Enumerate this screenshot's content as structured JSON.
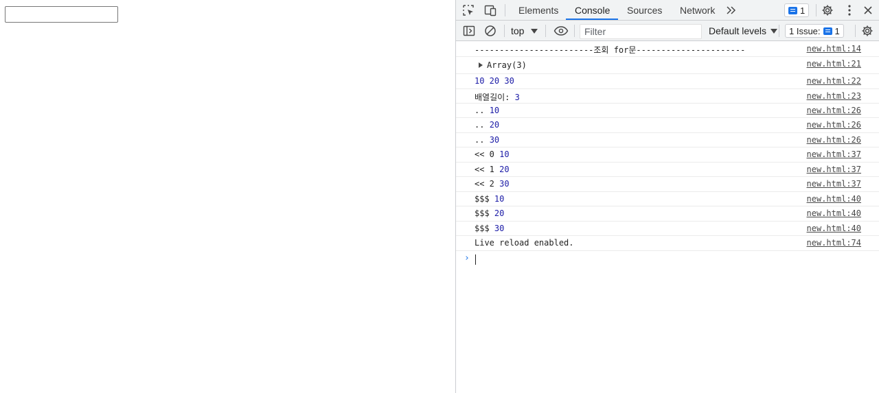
{
  "devtools": {
    "tabs": [
      "Elements",
      "Console",
      "Sources",
      "Network"
    ],
    "active_tab": "Console",
    "message_count": "1",
    "context": "top",
    "filter_placeholder": "Filter",
    "levels": "Default levels",
    "issues_label": "1 Issue:",
    "issues_count": "1",
    "accent_color": "#1a73e8"
  },
  "console": {
    "rows": [
      {
        "text": "------------------------조회 for문----------------------",
        "value": "",
        "source": "new.html:14"
      },
      {
        "text": "Array(3)",
        "value": "",
        "source": "new.html:21"
      },
      {
        "text": "",
        "value": "10 20 30",
        "source": "new.html:22"
      },
      {
        "text": "배열길이: ",
        "value": "3",
        "source": "new.html:23"
      },
      {
        "text": ".. ",
        "value": "10",
        "source": "new.html:26"
      },
      {
        "text": ".. ",
        "value": "20",
        "source": "new.html:26"
      },
      {
        "text": ".. ",
        "value": "30",
        "source": "new.html:26"
      },
      {
        "text": "<< 0 ",
        "value": "10",
        "source": "new.html:37"
      },
      {
        "text": "<< 1 ",
        "value": "20",
        "source": "new.html:37"
      },
      {
        "text": "<< 2 ",
        "value": "30",
        "source": "new.html:37"
      },
      {
        "text": "$$$ ",
        "value": "10",
        "source": "new.html:40"
      },
      {
        "text": "$$$ ",
        "value": "20",
        "source": "new.html:40"
      },
      {
        "text": "$$$ ",
        "value": "30",
        "source": "new.html:40"
      },
      {
        "text": "Live reload enabled.",
        "value": "",
        "source": "new.html:74"
      }
    ],
    "prompt": "›"
  }
}
